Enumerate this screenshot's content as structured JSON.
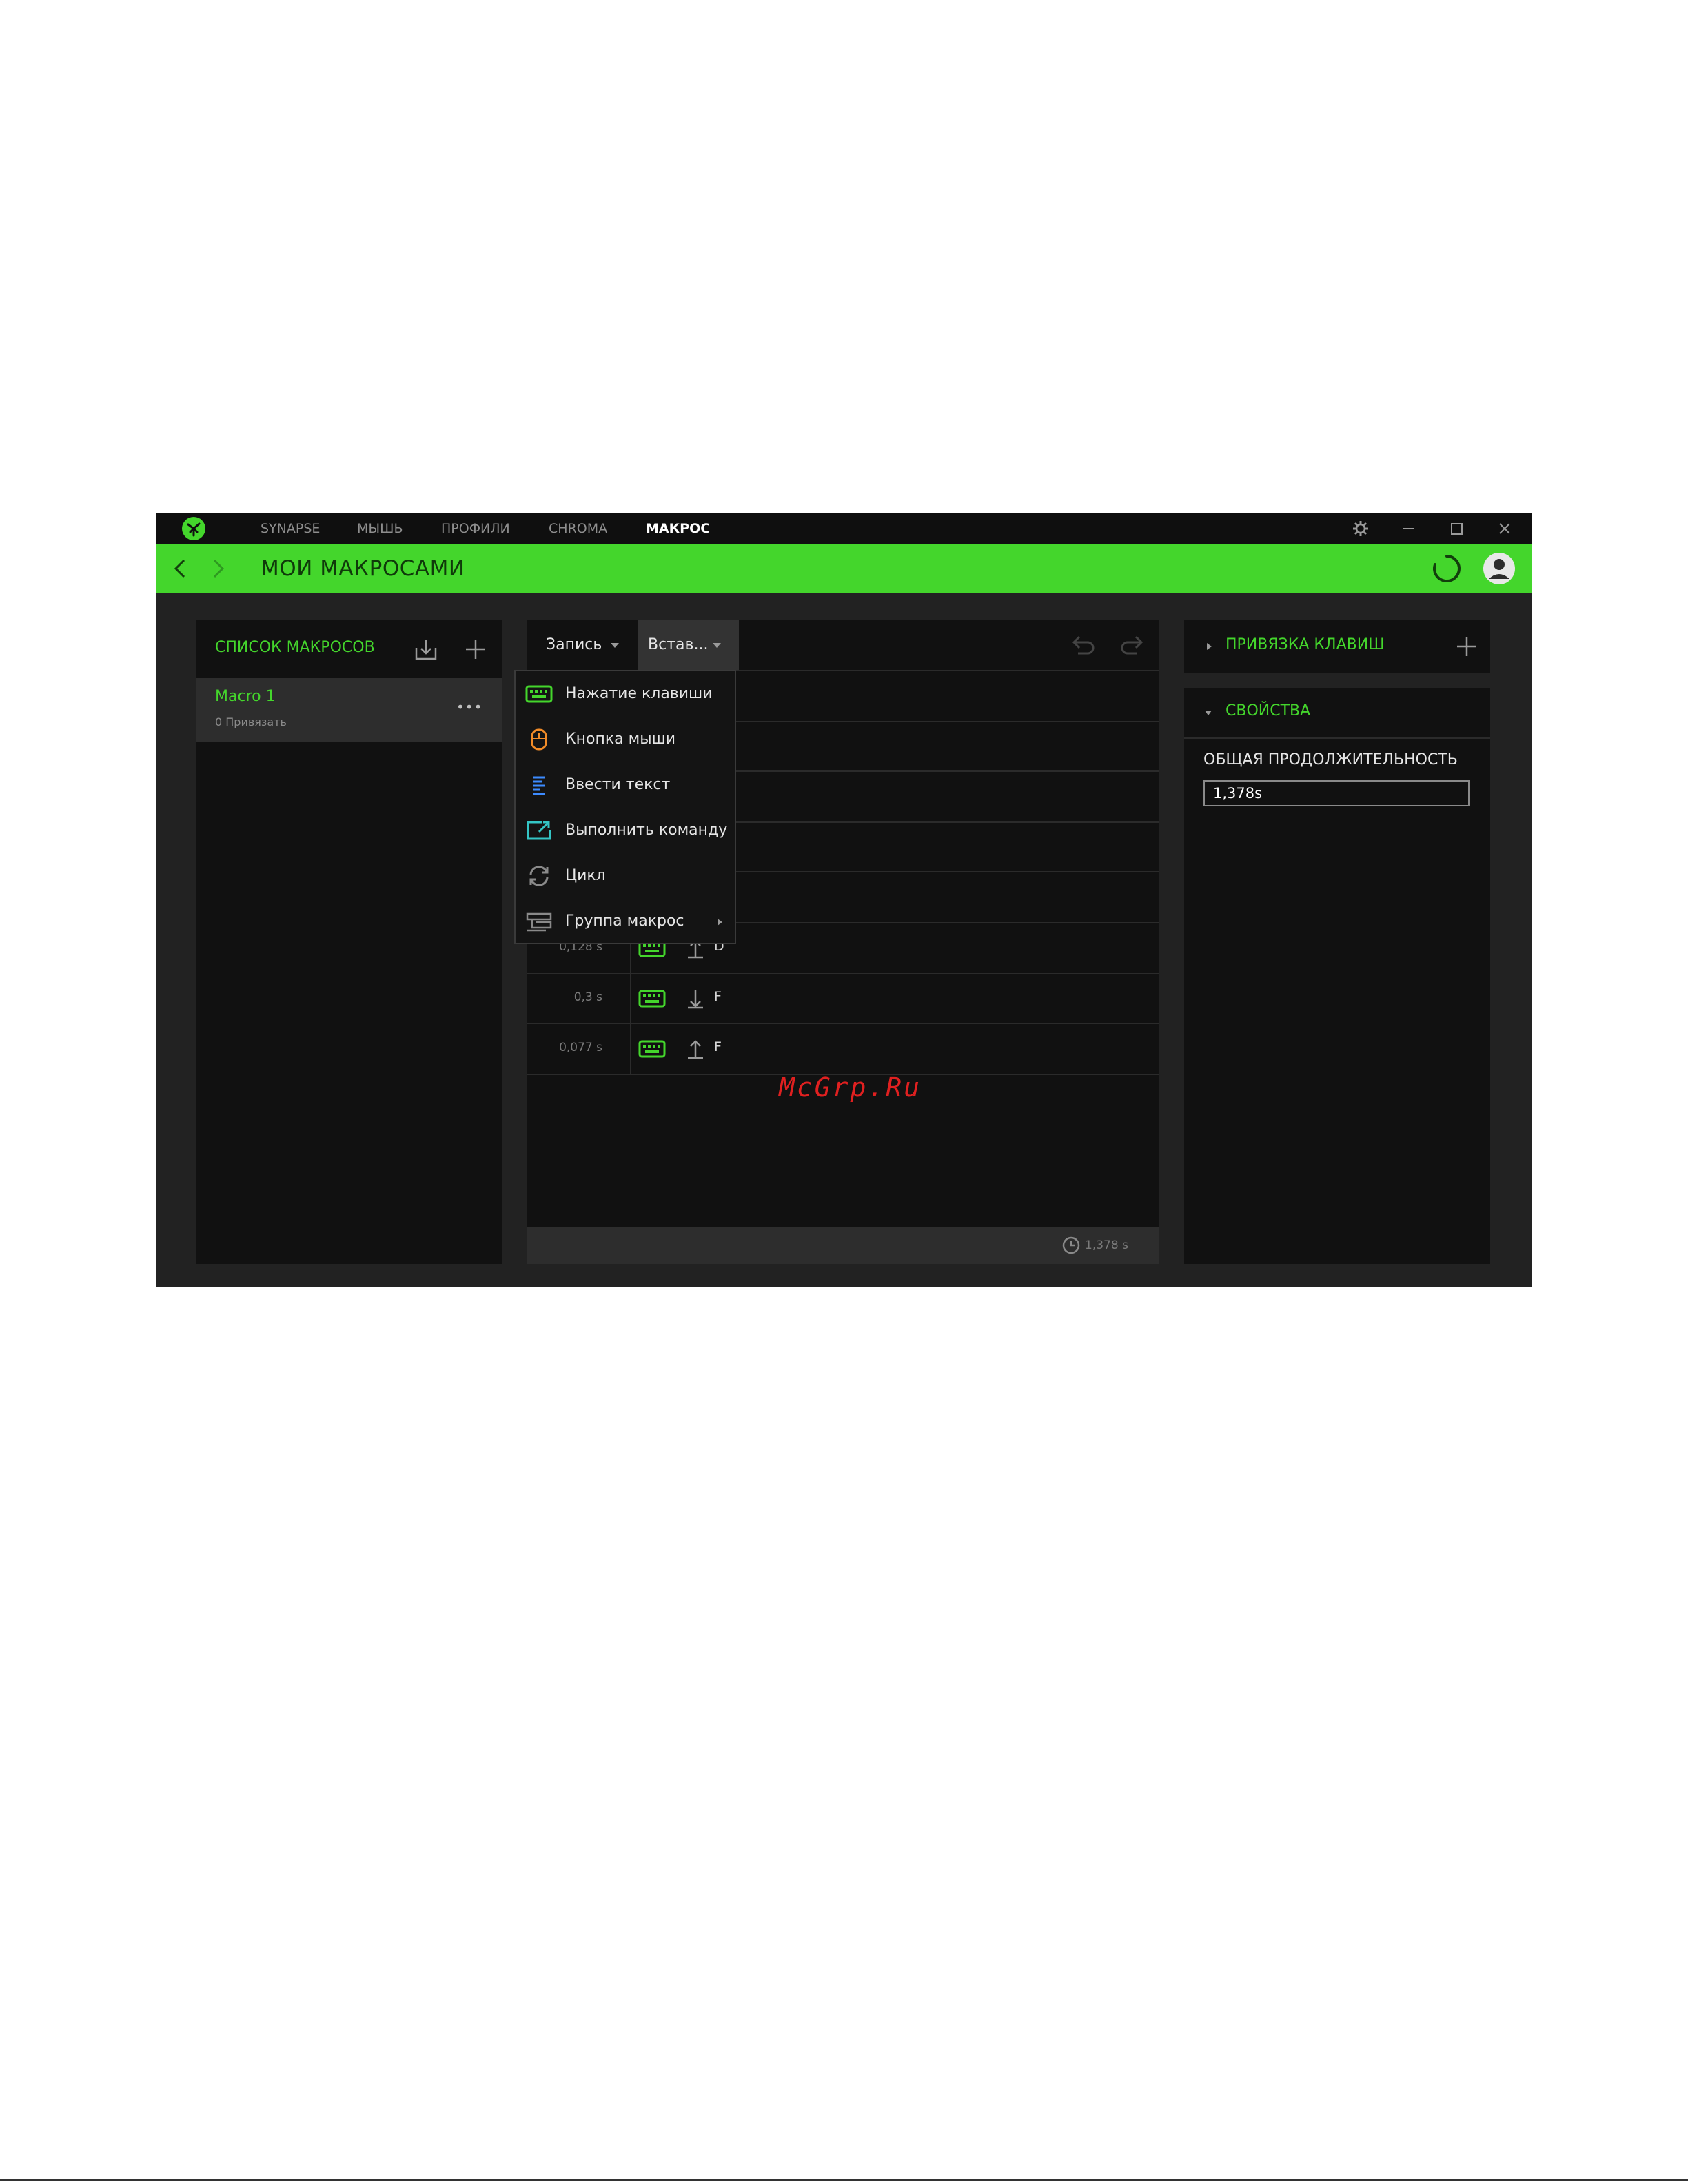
{
  "titlebar": {
    "nav": [
      {
        "label": "SYNAPSE",
        "active": false
      },
      {
        "label": "МЫШЬ",
        "active": false
      },
      {
        "label": "ПРОФИЛИ",
        "active": false
      },
      {
        "label": "CHROMA",
        "active": false
      },
      {
        "label": "МАКРОС",
        "active": true
      }
    ]
  },
  "header": {
    "title": "МОИ МАКРОСАМИ"
  },
  "macro_list": {
    "title": "СПИСОК МАКРОСОВ",
    "items": [
      {
        "name": "Macro 1",
        "subtitle": "0 Привязать",
        "more": "•••"
      }
    ]
  },
  "editor": {
    "record_label": "Запись",
    "insert_label": "Встав...",
    "events": [
      {
        "time": "0,128 s",
        "direction": "up",
        "key": "D"
      },
      {
        "time": "0,3 s",
        "direction": "down",
        "key": "F"
      },
      {
        "time": "0,077 s",
        "direction": "up",
        "key": "F"
      }
    ],
    "total_time": "1,378 s"
  },
  "insert_menu": {
    "items": [
      {
        "label": "Нажатие клавиши",
        "icon": "keyboard-icon",
        "color": "#44d62c"
      },
      {
        "label": "Кнопка мыши",
        "icon": "mouse-icon",
        "color": "#f28c28"
      },
      {
        "label": "Ввести текст",
        "icon": "text-icon",
        "color": "#3d8bff"
      },
      {
        "label": "Выполнить команду",
        "icon": "run-command-icon",
        "color": "#34c5c5"
      },
      {
        "label": "Цикл",
        "icon": "loop-icon",
        "color": "#8a8a8a"
      },
      {
        "label": "Группа макрос",
        "icon": "macro-group-icon",
        "color": "#8a8a8a"
      }
    ]
  },
  "keybind_panel": {
    "title": "ПРИВЯЗКА КЛАВИШ"
  },
  "properties_panel": {
    "title": "СВОЙСТВА",
    "duration_label": "ОБЩАЯ ПРОДОЛЖИТЕЛЬНОСТЬ",
    "duration_value": "1,378s"
  },
  "watermark": "McGrp.Ru",
  "colors": {
    "accent": "#44d62c",
    "background": "#222222",
    "panel": "#111111"
  }
}
